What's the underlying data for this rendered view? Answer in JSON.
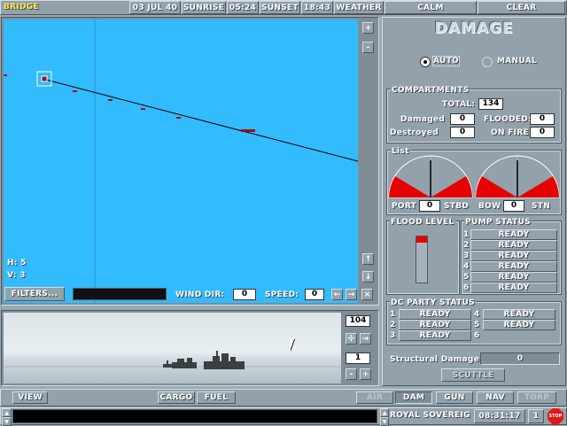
{
  "topbar": {
    "title": "BRIDGE",
    "date": "03 JUL 40",
    "sunrise_label": "SUNRISE",
    "sunrise_time": "05:24",
    "sunset_label": "SUNSET",
    "sunset_time": "18:43",
    "weather_label": "WEATHER",
    "weather_value": "CALM",
    "clear_button": "CLEAR"
  },
  "map": {
    "h_readout": "H: 5",
    "v_readout": "V: 3",
    "zoom_in": "+",
    "zoom_out": "-"
  },
  "map_controls": {
    "filters_label": "FILTERS...",
    "wind_label": "WIND DIR:",
    "wind_value": "0",
    "speed_label": "SPEED:",
    "speed_value": "0"
  },
  "view": {
    "zoom_value": "104",
    "index_value": "1"
  },
  "damage": {
    "title": "DAMAGE",
    "mode_auto": "AUTO",
    "mode_manual": "MANUAL",
    "compartments_label": "COMPARTMENTS",
    "total_label": "TOTAL:",
    "total_value": "134",
    "damaged_label": "Damaged",
    "damaged_value": "0",
    "flooded_label": "FLOODED:",
    "flooded_value": "0",
    "destroyed_label": "Destroyed",
    "destroyed_value": "0",
    "onfire_label": "ON FIRE:",
    "onfire_value": "0",
    "list_label": "List",
    "port_label": "PORT",
    "port_value": "0",
    "stbd_label": "STBD",
    "bow_label": "BOW",
    "bow_value": "0",
    "stn_label": "STN",
    "flood_label": "FLOOD LEVEL",
    "flood_level": 0.08,
    "pump_label": "PUMP STATUS",
    "pumps": [
      {
        "num": "1",
        "status": "READY"
      },
      {
        "num": "2",
        "status": "READY"
      },
      {
        "num": "3",
        "status": "READY"
      },
      {
        "num": "4",
        "status": "READY"
      },
      {
        "num": "5",
        "status": "READY"
      },
      {
        "num": "6",
        "status": "READY"
      }
    ],
    "dc_label": "DC PARTY STATUS",
    "dc_parties": [
      {
        "num": "1",
        "status": "READY"
      },
      {
        "num": "2",
        "status": "READY"
      },
      {
        "num": "3",
        "status": "READY"
      },
      {
        "num": "4",
        "status": "READY"
      },
      {
        "num": "5",
        "status": "READY"
      },
      {
        "num": "6",
        "status": ""
      }
    ],
    "structural_label": "Structural Damage",
    "structural_value": "0",
    "scuttle_label": "SCUTTLE"
  },
  "bottombar": {
    "view": "VIEW",
    "cargo": "CARGO",
    "fuel": "FUEL",
    "air": "AIR",
    "dam": "DAM",
    "gun": "GUN",
    "nav": "NAV",
    "torp": "TORP"
  },
  "statusbar": {
    "ship_name": "ROYAL SOVEREIG",
    "time": "08:31:17",
    "count": "1",
    "stop_label": "STOP"
  },
  "colors": {
    "sea": "#33bbff",
    "flood_red": "#e60000",
    "panel": "#93a1ab"
  }
}
